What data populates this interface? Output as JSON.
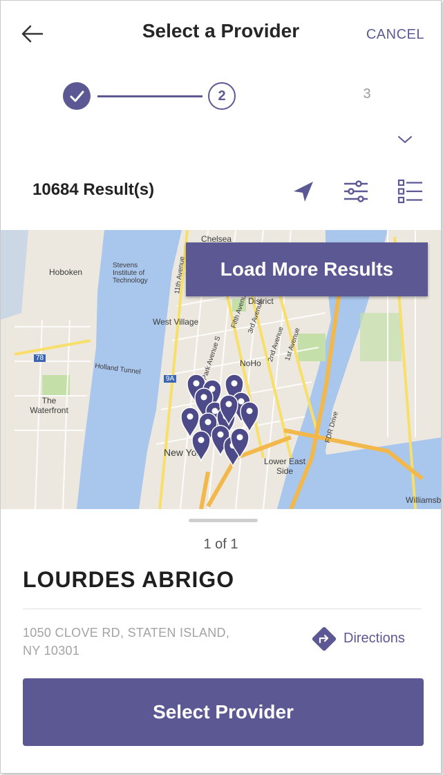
{
  "header": {
    "back_icon": "arrow-left-icon",
    "title": "Select a Provider",
    "cancel_label": "CANCEL"
  },
  "stepper": {
    "steps": [
      {
        "label": "",
        "state": "done",
        "icon": "check-icon"
      },
      {
        "label": "2",
        "state": "current"
      },
      {
        "label": "3",
        "state": "upcoming"
      }
    ],
    "expand_icon": "chevron-down-icon"
  },
  "results": {
    "count_text": "10684 Result(s)",
    "tools": [
      "navigation-arrow-icon",
      "filter-sliders-icon",
      "list-view-icon"
    ]
  },
  "map": {
    "load_more_label": "Load More Results",
    "labels": {
      "hoboken": "Hoboken",
      "stevens": "Stevens Institute of Technology",
      "chelsea": "Chelsea",
      "district": "District",
      "west_village": "West Village",
      "noho": "NoHo",
      "waterfront": "The Waterfront",
      "new_york": "New York",
      "lower_east_side": "Lower East Side",
      "fdr_drive": "FDR Drive",
      "williamsburg": "Williamsb",
      "holland_tunnel": "Holland Tunnel",
      "first_ave": "1st Avenue",
      "second_ave": "2nd Avenue",
      "third_ave": "3rd Avenue",
      "fifth_ave": "Fifth Avenue",
      "park_ave": "Park Avenue S",
      "eleventh_ave": "11th Avenue",
      "route_78": "78",
      "route_9a": "9A"
    },
    "pin_count": 15,
    "colors": {
      "water": "#a9c6ec",
      "land": "#ece8df",
      "park": "#c4dfa8",
      "road": "#f7df6a",
      "major_road": "#f2b84b",
      "pin": "#4d4a8a"
    }
  },
  "card": {
    "counter": "1 of 1",
    "name": "LOURDES ABRIGO",
    "address_line1": "1050 CLOVE RD, STATEN ISLAND,",
    "address_line2": "NY 10301",
    "directions_label": "Directions",
    "directions_icon": "directions-turn-icon",
    "select_label": "Select Provider"
  },
  "colors": {
    "accent": "#5b5893",
    "text_dark": "#222222",
    "text_muted": "#a3a3a3"
  }
}
